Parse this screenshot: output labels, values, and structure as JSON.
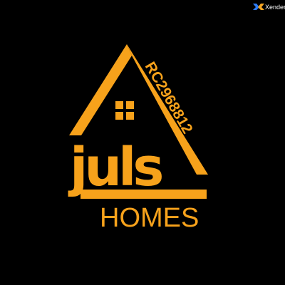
{
  "logo": {
    "brand_word": "juls",
    "subtitle": "HOMES",
    "registration": "RC2968812",
    "primary_color": "#F7A21B",
    "background_color": "#000000"
  },
  "watermark": {
    "app_name": "Xender",
    "icon": "xender-logo-icon",
    "color": "#FFFFFF"
  }
}
